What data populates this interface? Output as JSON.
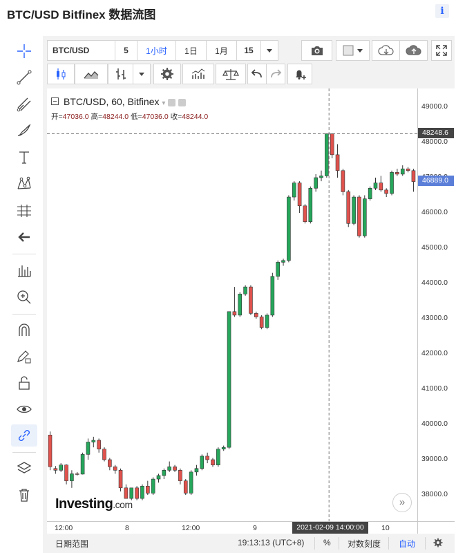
{
  "page": {
    "title": "BTC/USD Bitfinex 数据流图",
    "info_icon": "i"
  },
  "toolbar": {
    "symbol": "BTC/USD",
    "intervals": [
      "5",
      "1小时",
      "1日",
      "1月",
      "15"
    ],
    "active_interval": "1小时"
  },
  "legend": {
    "title": "BTC/USD, 60, Bitfinex",
    "open_label": "开=",
    "open": "47036.0",
    "high_label": "高=",
    "high": "48244.0",
    "low_label": "低=",
    "low": "47036.0",
    "close_label": "收=",
    "close": "48244.0"
  },
  "price_axis": {
    "labels": [
      "49000.0",
      "48000.0",
      "47000.0",
      "46000.0",
      "45000.0",
      "44000.0",
      "43000.0",
      "42000.0",
      "41000.0",
      "40000.0",
      "39000.0",
      "38000.0"
    ],
    "crosshair_price": "48248.6",
    "last_price": "46889.0"
  },
  "time_axis": {
    "labels": [
      "12:00",
      "8",
      "12:00",
      "9",
      "10"
    ],
    "crosshair_time": "2021-02-09 14:00:00"
  },
  "branding": {
    "logo": "Investing",
    "logo_suffix": ".com"
  },
  "bottom_bar": {
    "date_range": "日期范围",
    "clock": "19:13:13",
    "timezone": "(UTC+8)",
    "percent": "%",
    "log_scale": "对数刻度",
    "auto": "自动"
  },
  "colors": {
    "up": "#26a65b",
    "down": "#e0524d",
    "last_price_tag": "#5b7fd9",
    "crosshair_tag": "#444444",
    "accent": "#2962ff"
  },
  "chart_data": {
    "type": "candlestick",
    "symbol": "BTC/USD",
    "interval": "60",
    "exchange": "Bitfinex",
    "ylim": [
      37300,
      49300
    ],
    "y_ticks": [
      38000,
      39000,
      40000,
      41000,
      42000,
      43000,
      44000,
      45000,
      46000,
      47000,
      48000,
      49000
    ],
    "x_tick_labels": [
      "12:00",
      "8",
      "12:00",
      "9",
      "10"
    ],
    "crosshair": {
      "price": 48248.6,
      "time": "2021-02-09 14:00:00"
    },
    "last_price": 46889.0,
    "candles": [
      {
        "o": 39700,
        "h": 39800,
        "l": 38700,
        "c": 38800
      },
      {
        "o": 38750,
        "h": 38820,
        "l": 38600,
        "c": 38700
      },
      {
        "o": 38700,
        "h": 38900,
        "l": 38650,
        "c": 38850
      },
      {
        "o": 38850,
        "h": 38870,
        "l": 38300,
        "c": 38400
      },
      {
        "o": 38400,
        "h": 38700,
        "l": 38200,
        "c": 38600
      },
      {
        "o": 38600,
        "h": 38650,
        "l": 38550,
        "c": 38590
      },
      {
        "o": 38590,
        "h": 39200,
        "l": 38580,
        "c": 39150
      },
      {
        "o": 39150,
        "h": 39600,
        "l": 39000,
        "c": 39500
      },
      {
        "o": 39500,
        "h": 39650,
        "l": 39350,
        "c": 39550
      },
      {
        "o": 39550,
        "h": 39600,
        "l": 39200,
        "c": 39300
      },
      {
        "o": 39300,
        "h": 39350,
        "l": 38950,
        "c": 39000
      },
      {
        "o": 39000,
        "h": 39050,
        "l": 38700,
        "c": 38800
      },
      {
        "o": 38800,
        "h": 38850,
        "l": 38600,
        "c": 38700
      },
      {
        "o": 38700,
        "h": 38750,
        "l": 38100,
        "c": 38200
      },
      {
        "o": 38200,
        "h": 38300,
        "l": 37900,
        "c": 37900
      },
      {
        "o": 37900,
        "h": 38200,
        "l": 37850,
        "c": 38200
      },
      {
        "o": 38200,
        "h": 38250,
        "l": 37850,
        "c": 37900
      },
      {
        "o": 37900,
        "h": 38300,
        "l": 37850,
        "c": 38250
      },
      {
        "o": 38250,
        "h": 38400,
        "l": 38000,
        "c": 38050
      },
      {
        "o": 38050,
        "h": 38500,
        "l": 38000,
        "c": 38450
      },
      {
        "o": 38450,
        "h": 38600,
        "l": 38350,
        "c": 38550
      },
      {
        "o": 38550,
        "h": 38750,
        "l": 38450,
        "c": 38700
      },
      {
        "o": 38700,
        "h": 38950,
        "l": 38650,
        "c": 38800
      },
      {
        "o": 38800,
        "h": 38850,
        "l": 38650,
        "c": 38700
      },
      {
        "o": 38700,
        "h": 38750,
        "l": 38300,
        "c": 38400
      },
      {
        "o": 38400,
        "h": 38450,
        "l": 38000,
        "c": 38050
      },
      {
        "o": 38050,
        "h": 38700,
        "l": 38000,
        "c": 38650
      },
      {
        "o": 38650,
        "h": 38850,
        "l": 38550,
        "c": 38750
      },
      {
        "o": 38750,
        "h": 39150,
        "l": 38700,
        "c": 39100
      },
      {
        "o": 39100,
        "h": 39200,
        "l": 38900,
        "c": 39000
      },
      {
        "o": 39000,
        "h": 39050,
        "l": 38800,
        "c": 38850
      },
      {
        "o": 38850,
        "h": 39350,
        "l": 38800,
        "c": 39300
      },
      {
        "o": 39300,
        "h": 39400,
        "l": 39250,
        "c": 39350
      },
      {
        "o": 39350,
        "h": 43200,
        "l": 39300,
        "c": 43200
      },
      {
        "o": 43200,
        "h": 43900,
        "l": 43050,
        "c": 43100
      },
      {
        "o": 43100,
        "h": 43750,
        "l": 43050,
        "c": 43700
      },
      {
        "o": 43700,
        "h": 43950,
        "l": 43650,
        "c": 43900
      },
      {
        "o": 43900,
        "h": 43950,
        "l": 43100,
        "c": 43150
      },
      {
        "o": 43150,
        "h": 43200,
        "l": 43000,
        "c": 43050
      },
      {
        "o": 43050,
        "h": 43100,
        "l": 42700,
        "c": 42750
      },
      {
        "o": 42750,
        "h": 43150,
        "l": 42700,
        "c": 43100
      },
      {
        "o": 43100,
        "h": 44300,
        "l": 43050,
        "c": 44200
      },
      {
        "o": 44200,
        "h": 44650,
        "l": 44100,
        "c": 44600
      },
      {
        "o": 44600,
        "h": 44700,
        "l": 44500,
        "c": 44650
      },
      {
        "o": 44650,
        "h": 46500,
        "l": 44600,
        "c": 46450
      },
      {
        "o": 46450,
        "h": 46900,
        "l": 46350,
        "c": 46850
      },
      {
        "o": 46850,
        "h": 46900,
        "l": 46000,
        "c": 46200
      },
      {
        "o": 46200,
        "h": 46250,
        "l": 45700,
        "c": 45750
      },
      {
        "o": 45750,
        "h": 46750,
        "l": 45700,
        "c": 46700
      },
      {
        "o": 46700,
        "h": 47100,
        "l": 46600,
        "c": 47000
      },
      {
        "o": 47000,
        "h": 47200,
        "l": 46900,
        "c": 47050
      },
      {
        "o": 47050,
        "h": 48250,
        "l": 47000,
        "c": 48244
      },
      {
        "o": 48244,
        "h": 48250,
        "l": 47550,
        "c": 47650
      },
      {
        "o": 47650,
        "h": 47950,
        "l": 47000,
        "c": 47200
      },
      {
        "o": 47200,
        "h": 47250,
        "l": 46500,
        "c": 46600
      },
      {
        "o": 46600,
        "h": 46650,
        "l": 45600,
        "c": 45700
      },
      {
        "o": 45700,
        "h": 46500,
        "l": 45650,
        "c": 46450
      },
      {
        "o": 46450,
        "h": 46500,
        "l": 45300,
        "c": 45350
      },
      {
        "o": 45350,
        "h": 46500,
        "l": 45300,
        "c": 46400
      },
      {
        "o": 46400,
        "h": 46750,
        "l": 46350,
        "c": 46700
      },
      {
        "o": 46700,
        "h": 47000,
        "l": 46650,
        "c": 46850
      },
      {
        "o": 46850,
        "h": 47050,
        "l": 46600,
        "c": 46650
      },
      {
        "o": 46650,
        "h": 46700,
        "l": 46450,
        "c": 46550
      },
      {
        "o": 46550,
        "h": 47200,
        "l": 46500,
        "c": 47150
      },
      {
        "o": 47150,
        "h": 47250,
        "l": 47050,
        "c": 47100
      },
      {
        "o": 47100,
        "h": 47350,
        "l": 47050,
        "c": 47250
      },
      {
        "o": 47250,
        "h": 47300,
        "l": 47150,
        "c": 47200
      },
      {
        "o": 47200,
        "h": 47250,
        "l": 46600,
        "c": 46889
      }
    ]
  }
}
